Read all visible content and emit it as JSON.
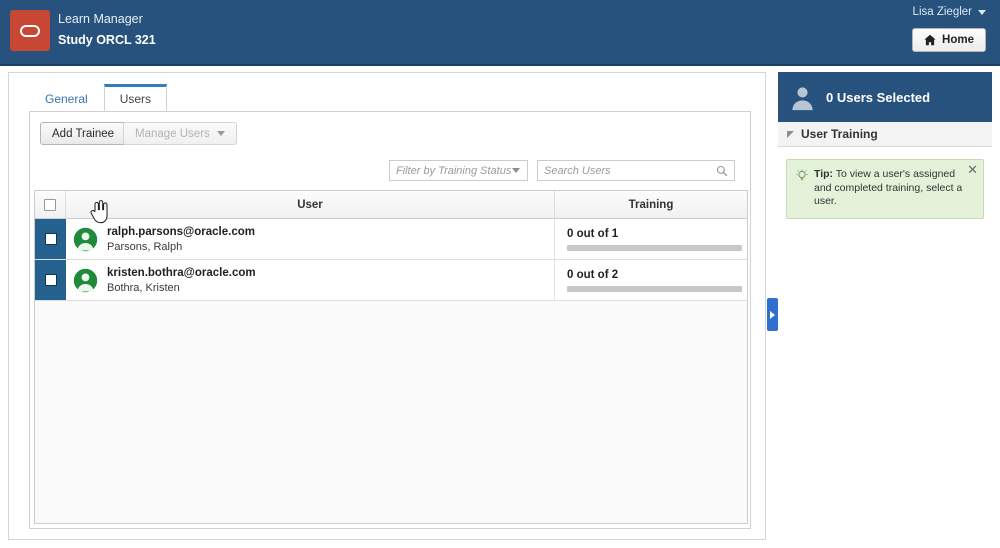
{
  "header": {
    "logo_icon": "oracle-logo-icon",
    "app_name": "Learn Manager",
    "study_name": "Study ORCL 321",
    "user_name": "Lisa Ziegler",
    "home_label": "Home",
    "home_icon": "house-icon",
    "accent_color": "#27527d",
    "logo_color": "#c74634"
  },
  "tabs": [
    {
      "label": "General",
      "active": false
    },
    {
      "label": "Users",
      "active": true
    }
  ],
  "toolbar": {
    "add_trainee_label": "Add Trainee",
    "manage_users_label": "Manage Users",
    "manage_users_disabled": true,
    "filter_placeholder": "Filter by Training Status",
    "search_placeholder": "Search Users",
    "search_value": "",
    "search_icon": "search-icon"
  },
  "table": {
    "columns": [
      "",
      "User",
      "Training"
    ],
    "rows": [
      {
        "selected": false,
        "email": "ralph.parsons@oracle.com",
        "name": "Parsons, Ralph",
        "training_label": "0 out of 1",
        "training_completed": 0,
        "training_total": 1,
        "progress_percent": 0
      },
      {
        "selected": false,
        "email": "kristen.bothra@oracle.com",
        "name": "Bothra, Kristen",
        "training_label": "0 out of 2",
        "training_completed": 0,
        "training_total": 2,
        "progress_percent": 0
      }
    ]
  },
  "sidebar": {
    "header_title": "0 Users Selected",
    "header_icon": "person-icon",
    "section_title": "User Training",
    "tip_label": "Tip:",
    "tip_text": "To view a user's assigned and completed training, select a user.",
    "tip_icon": "lightbulb-icon",
    "tip_close_icon": "close-icon",
    "tip_bg_color": "#e3f2d9",
    "handle_icon": "chevron-right-icon"
  }
}
